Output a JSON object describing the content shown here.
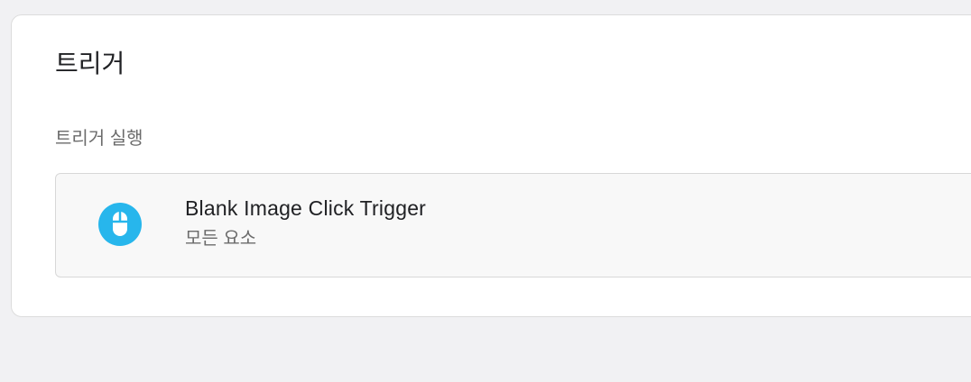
{
  "card": {
    "title": "트리거",
    "section_label": "트리거 실행"
  },
  "trigger": {
    "name": "Blank Image Click Trigger",
    "scope": "모든 요소",
    "icon": "mouse-icon",
    "icon_color": "#27b6ec"
  }
}
